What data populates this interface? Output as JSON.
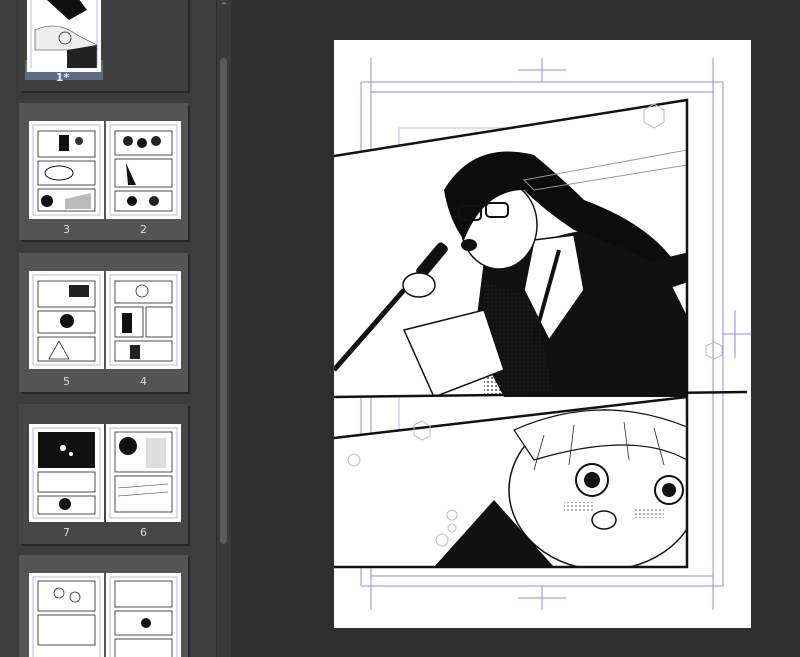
{
  "page_manager": {
    "spreads": [
      {
        "pages": [
          {
            "number": "1*"
          }
        ]
      },
      {
        "pages": [
          {
            "number": "3"
          },
          {
            "number": "2"
          }
        ]
      },
      {
        "pages": [
          {
            "number": "5"
          },
          {
            "number": "4"
          }
        ]
      },
      {
        "pages": [
          {
            "number": "7"
          },
          {
            "number": "6"
          }
        ]
      },
      {
        "pages": []
      }
    ]
  },
  "scrollbar": {
    "up_glyph": "⌃"
  },
  "canvas": {
    "page_label": "manga page artwork"
  },
  "colors": {
    "panel_bg": "#3c3c3c",
    "workspace_bg": "#2f2f2f",
    "selected_page": "#5c6a86",
    "guide_blue": "#6b6bd6"
  }
}
